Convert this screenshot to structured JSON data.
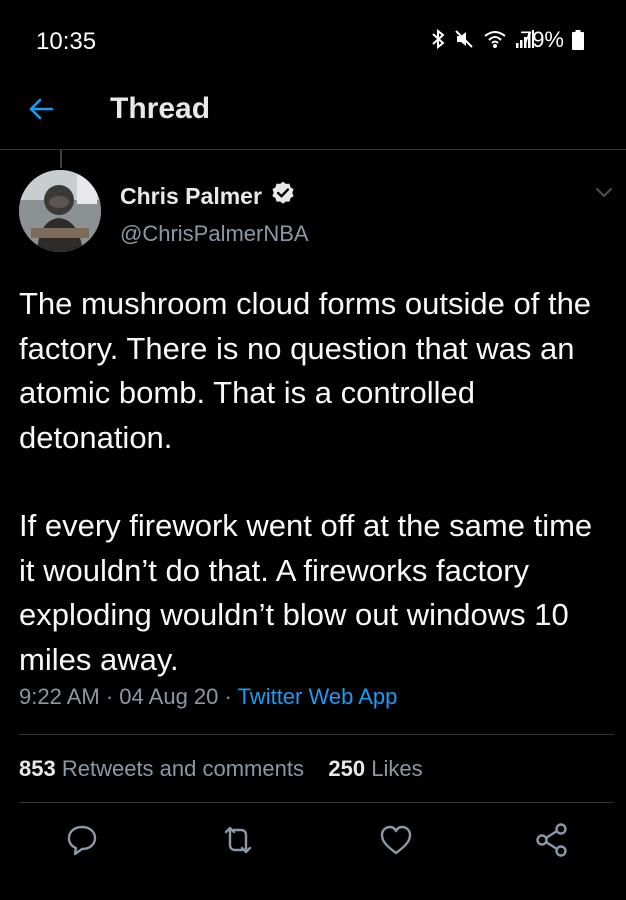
{
  "status_bar": {
    "time": "10:35",
    "battery": "79%",
    "icons": [
      "bluetooth-icon",
      "mute-icon",
      "wifi-icon",
      "signal-icon",
      "battery-icon"
    ]
  },
  "topbar": {
    "title": "Thread",
    "back_icon": "arrow-left-icon"
  },
  "tweet": {
    "author_name": "Chris Palmer",
    "author_handle": "@ChrisPalmerNBA",
    "verified": true,
    "text_paragraphs": [
      "The mushroom cloud forms outside of the factory. There is no question that was an atomic bomb. That is a controlled detonation.",
      "If every firework went off at the same time it wouldn’t do that. A fireworks factory exploding wouldn’t blow out windows 10 miles away."
    ],
    "time": "9:22 AM",
    "date": "04 Aug 20",
    "separator": "·",
    "source": "Twitter Web App",
    "retweets_count": "853",
    "retweets_label": "Retweets and comments",
    "likes_count": "250",
    "likes_label": "Likes"
  },
  "actions": [
    "reply-icon",
    "retweet-icon",
    "like-icon",
    "share-icon"
  ],
  "colors": {
    "background": "#000000",
    "text": "#e7e9ea",
    "secondary": "#8b98a5",
    "accent": "#1d9bf0",
    "divider": "#2f3336"
  }
}
